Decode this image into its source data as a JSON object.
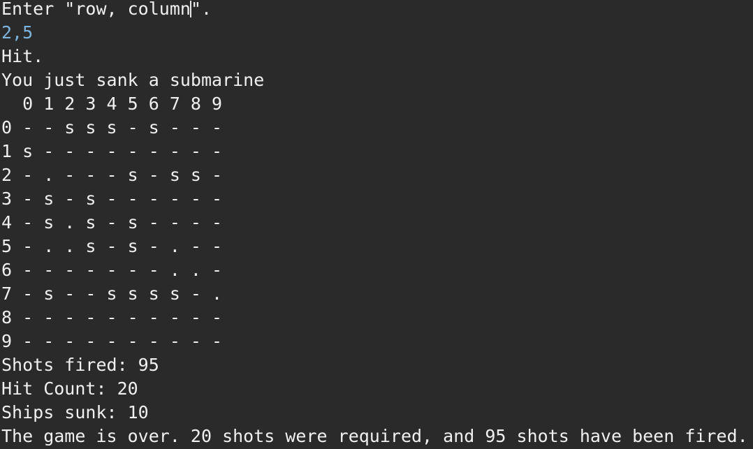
{
  "prompt": {
    "text_before_caret": "Enter \"row, column",
    "text_after_caret": "\"."
  },
  "user_input": "2,5",
  "result": "Hit.",
  "sunk_message": "You just sank a submarine",
  "board": {
    "header": "  0 1 2 3 4 5 6 7 8 9",
    "rows": [
      "0 - - s s s - s - - -",
      "1 s - - - - - - - - -",
      "2 - . - - - s - s s -",
      "3 - s - s - - - - - -",
      "4 - s . s - s - - - -",
      "5 - . . s - s - . - -",
      "6 - - - - - - - . . -",
      "7 - s - - s s s s - .",
      "8 - - - - - - - - - -",
      "9 - - - - - - - - - -"
    ]
  },
  "stats": {
    "shots_fired": "Shots fired: 95",
    "hit_count": "Hit Count: 20",
    "ships_sunk": "Ships sunk: 10"
  },
  "game_over": "The game is over. 20 shots were required, and 95 shots have been fired.",
  "colors": {
    "background": "#2a2a2a",
    "text": "#f0f0f0",
    "input_text": "#7cb4e0"
  }
}
